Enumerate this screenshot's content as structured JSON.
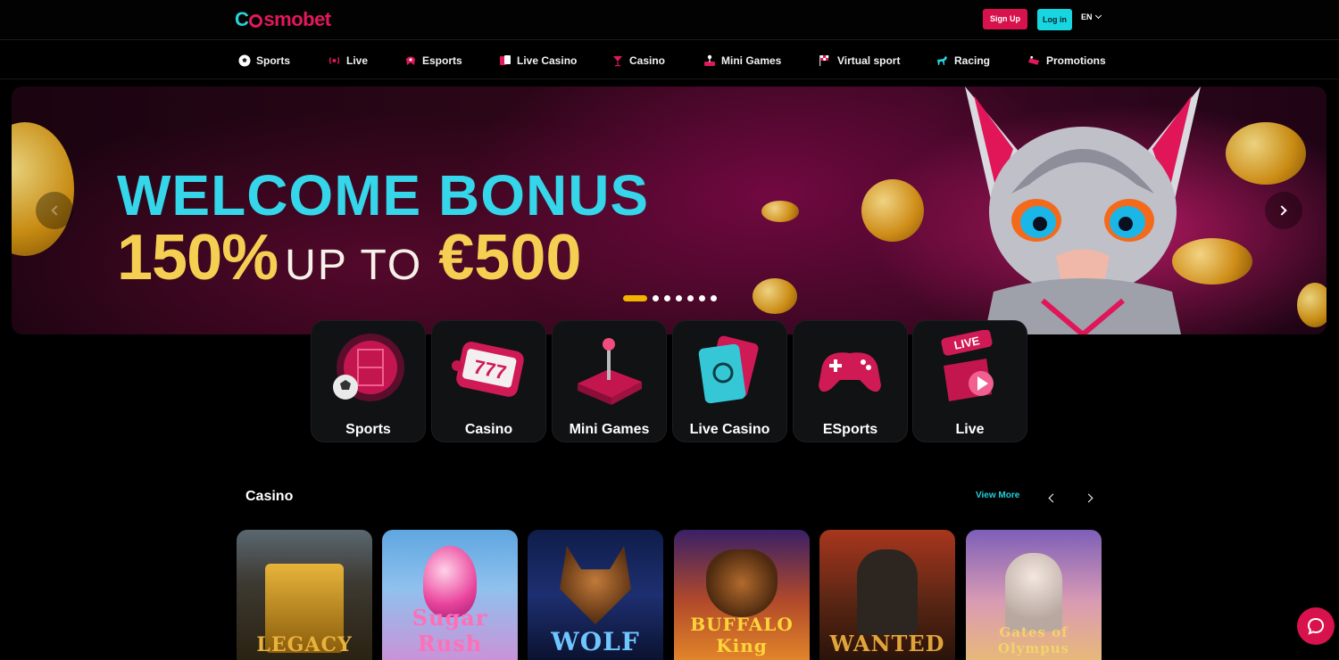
{
  "header": {
    "logo_part1": "C",
    "logo_part2": "smobet",
    "signup_label": "Sign Up",
    "login_label": "Log in",
    "language": "EN"
  },
  "nav": {
    "items": [
      {
        "label": "Sports",
        "icon": "soccer-ball-icon"
      },
      {
        "label": "Live",
        "icon": "broadcast-icon"
      },
      {
        "label": "Esports",
        "icon": "esports-icon"
      },
      {
        "label": "Live Casino",
        "icon": "cards-icon"
      },
      {
        "label": "Casino",
        "icon": "cocktail-icon"
      },
      {
        "label": "Mini Games",
        "icon": "joystick-icon"
      },
      {
        "label": "Virtual sport",
        "icon": "checkered-flag-icon"
      },
      {
        "label": "Racing",
        "icon": "horse-icon"
      },
      {
        "label": "Promotions",
        "icon": "gift-icon"
      }
    ]
  },
  "banner": {
    "headline": "WELCOME BONUS",
    "percent": "150%",
    "up_to": "UP TO",
    "amount": "€500",
    "slide_count": 7,
    "active_slide": 1
  },
  "categories": [
    {
      "label": "Sports",
      "icon": "sports-stadium-icon"
    },
    {
      "label": "Casino",
      "icon": "slot-machine-icon"
    },
    {
      "label": "Mini Games",
      "icon": "arcade-joystick-icon"
    },
    {
      "label": "Live Casino",
      "icon": "live-cards-icon"
    },
    {
      "label": "ESports",
      "icon": "gamepad-icon"
    },
    {
      "label": "Live",
      "icon": "live-badge-icon"
    }
  ],
  "casino_section": {
    "title": "Casino",
    "view_more": "View More",
    "games": [
      {
        "title": "LEGACY",
        "theme": "egypt"
      },
      {
        "title": "Sugar Rush",
        "theme": "candy"
      },
      {
        "title": "WOLF",
        "theme": "wolf"
      },
      {
        "title": "BUFFALO King",
        "theme": "buffalo"
      },
      {
        "title": "WANTED",
        "theme": "western"
      },
      {
        "title": "Gates of Olympus",
        "theme": "olympus"
      }
    ]
  },
  "colors": {
    "brand_pink": "#d8124d",
    "brand_cyan": "#17d6e0",
    "gold": "#f5cf52"
  }
}
